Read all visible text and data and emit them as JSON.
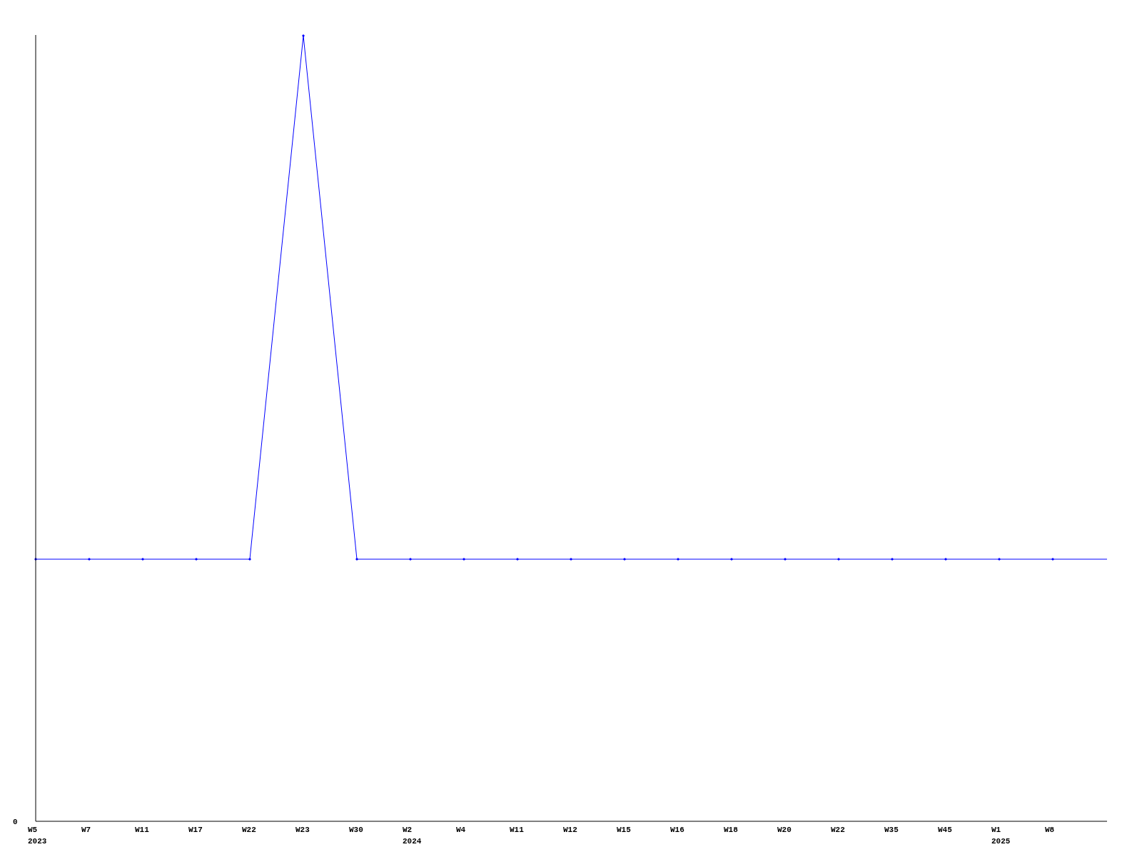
{
  "chart": {
    "y_axis": {
      "ticks": [
        "0"
      ]
    },
    "x_axis": {
      "ticks": [
        {
          "label": "W5",
          "year": "2023"
        },
        {
          "label": "W7"
        },
        {
          "label": "W11"
        },
        {
          "label": "W17"
        },
        {
          "label": "W22"
        },
        {
          "label": "W23"
        },
        {
          "label": "W30"
        },
        {
          "label": "W2",
          "year": "2024"
        },
        {
          "label": "W4"
        },
        {
          "label": "W11"
        },
        {
          "label": "W12"
        },
        {
          "label": "W15"
        },
        {
          "label": "W16"
        },
        {
          "label": "W18"
        },
        {
          "label": "W20"
        },
        {
          "label": "W22"
        },
        {
          "label": "W35"
        },
        {
          "label": "W45"
        },
        {
          "label": "W1",
          "year": "2025"
        },
        {
          "label": "W8"
        }
      ]
    }
  }
}
